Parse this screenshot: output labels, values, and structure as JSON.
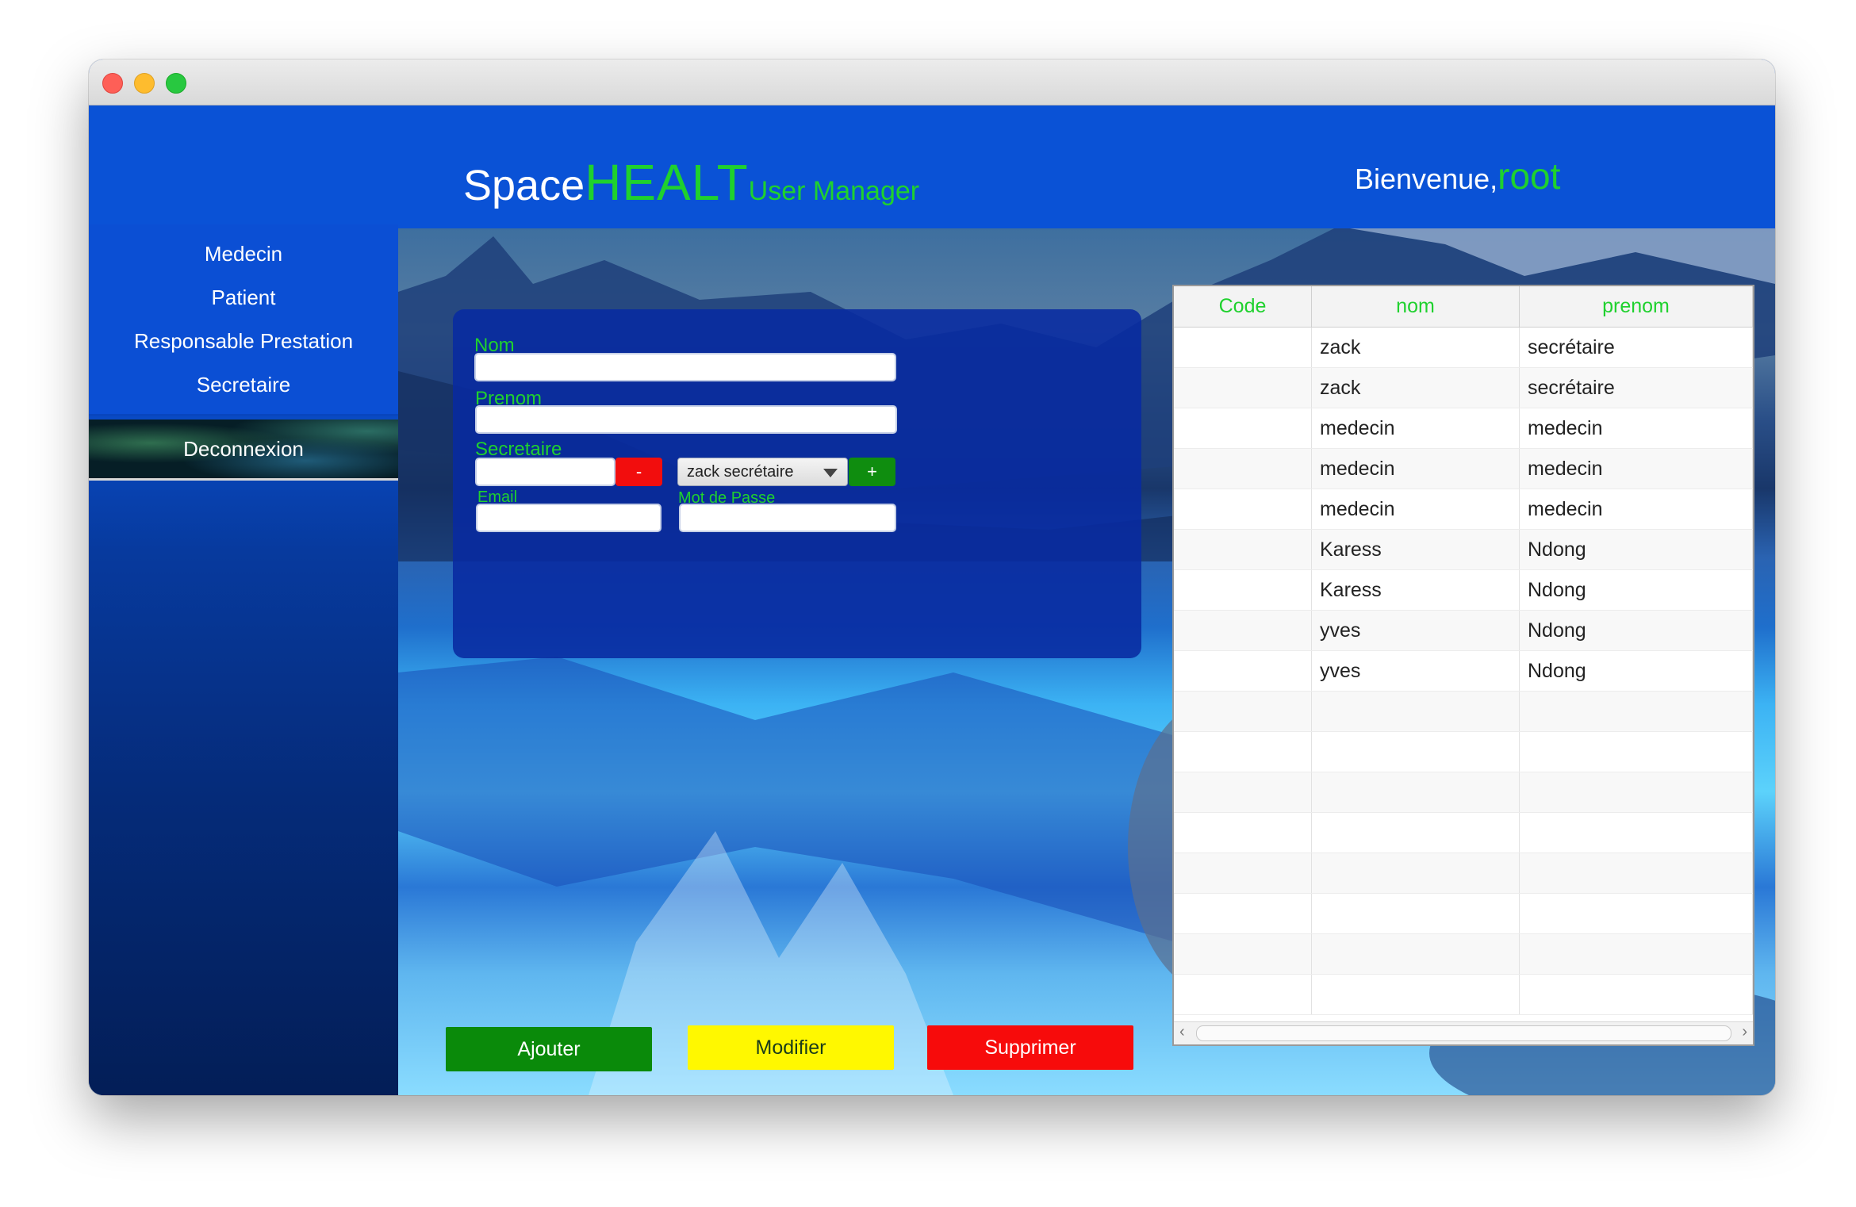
{
  "window": {
    "controls": [
      "close",
      "minimize",
      "zoom"
    ]
  },
  "header": {
    "title_word1": "Space",
    "title_word2": "HEALT",
    "title_word3": "User Manager",
    "welcome_label": "Bienvenue,",
    "username": "root"
  },
  "sidebar": {
    "items": [
      {
        "label": "Medecin"
      },
      {
        "label": "Patient"
      },
      {
        "label": "Responsable Prestation"
      },
      {
        "label": "Secretaire"
      }
    ],
    "logout_label": "Deconnexion"
  },
  "form": {
    "nom_label": "Nom",
    "nom_value": "",
    "prenom_label": "Prenom",
    "prenom_value": "",
    "role_label": "Secretaire",
    "role_value": "",
    "minus_label": "-",
    "select_value": "zack secrétaire",
    "plus_label": "+",
    "email_label": "Email",
    "email_value": "",
    "password_label": "Mot de Passe",
    "password_value": ""
  },
  "actions": {
    "add_label": "Ajouter",
    "edit_label": "Modifier",
    "delete_label": "Supprimer"
  },
  "table": {
    "columns": [
      "Code",
      "nom",
      "prenom"
    ],
    "rows": [
      [
        "",
        "zack",
        "secrétaire"
      ],
      [
        "",
        "zack",
        "secrétaire"
      ],
      [
        "",
        "medecin",
        "medecin"
      ],
      [
        "",
        "medecin",
        "medecin"
      ],
      [
        "",
        "medecin",
        "medecin"
      ],
      [
        "",
        "Karess",
        "Ndong"
      ],
      [
        "",
        "Karess",
        "Ndong"
      ],
      [
        "",
        "yves",
        "Ndong"
      ],
      [
        "",
        "yves",
        "Ndong"
      ],
      [
        "",
        "",
        ""
      ],
      [
        "",
        "",
        ""
      ],
      [
        "",
        "",
        ""
      ],
      [
        "",
        "",
        ""
      ],
      [
        "",
        "",
        ""
      ],
      [
        "",
        "",
        ""
      ],
      [
        "",
        "",
        ""
      ],
      [
        "",
        "",
        ""
      ]
    ]
  },
  "colors": {
    "brand_blue": "#0a52d6",
    "accent_green": "#1fd12e",
    "add_green": "#0a8a0a",
    "edit_yellow": "#fff800",
    "delete_red": "#f70b0b"
  }
}
